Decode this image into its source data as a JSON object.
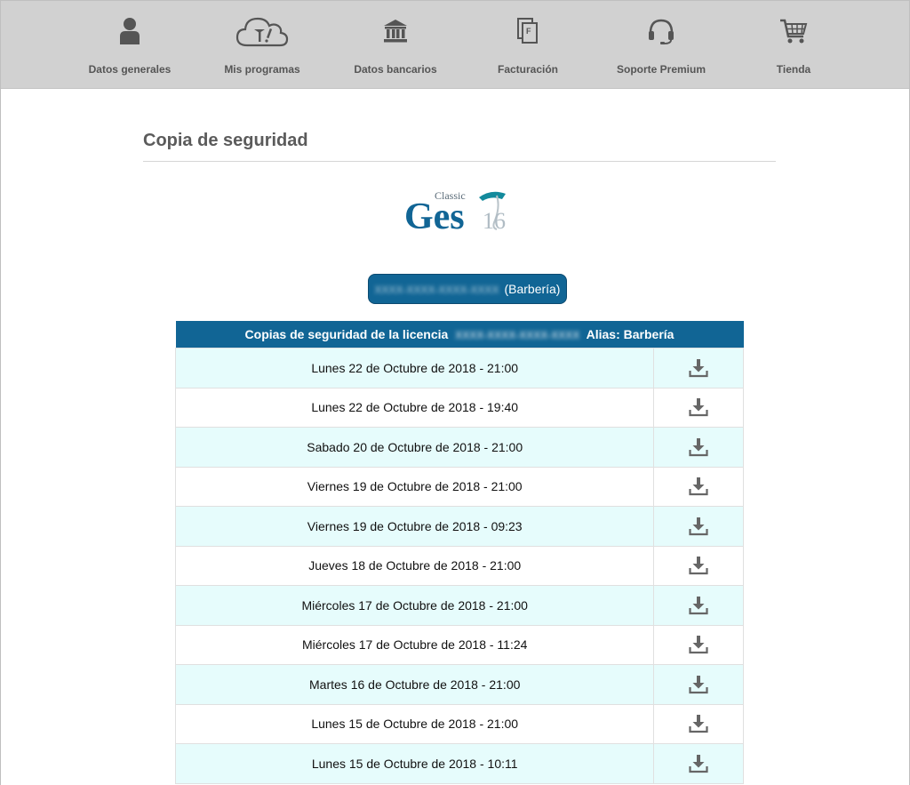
{
  "nav": {
    "items": [
      {
        "label": "Datos generales",
        "icon": "user-icon"
      },
      {
        "label": "Mis programas",
        "icon": "cloud-tools-icon"
      },
      {
        "label": "Datos bancarios",
        "icon": "bank-icon"
      },
      {
        "label": "Facturación",
        "icon": "invoice-icon"
      },
      {
        "label": "Soporte Premium",
        "icon": "headset-icon"
      },
      {
        "label": "Tienda",
        "icon": "cart-icon"
      }
    ]
  },
  "page": {
    "title": "Copia de seguridad"
  },
  "logo": {
    "classic": "Classic",
    "ges": "Ges",
    "version": "16",
    "brand_color": "#116595"
  },
  "license": {
    "alias_label": "(Barbería)"
  },
  "table": {
    "header_prefix": "Copias de seguridad de la licencia",
    "header_suffix": "Alias: Barbería",
    "rows": [
      {
        "date": "Lunes 22 de Octubre de 2018 - 21:00"
      },
      {
        "date": "Lunes 22 de Octubre de 2018 - 19:40"
      },
      {
        "date": "Sabado 20 de Octubre de 2018 - 21:00"
      },
      {
        "date": "Viernes 19 de Octubre de 2018 - 21:00"
      },
      {
        "date": "Viernes 19 de Octubre de 2018 - 09:23"
      },
      {
        "date": "Jueves 18 de Octubre de 2018 - 21:00"
      },
      {
        "date": "Miércoles 17 de Octubre de 2018 - 21:00"
      },
      {
        "date": "Miércoles 17 de Octubre de 2018 - 11:24"
      },
      {
        "date": "Martes 16 de Octubre de 2018 - 21:00"
      },
      {
        "date": "Lunes 15 de Octubre de 2018 - 21:00"
      },
      {
        "date": "Lunes 15 de Octubre de 2018 - 10:11"
      }
    ]
  },
  "colors": {
    "nav_bg": "#d1d1d1",
    "header_bg": "#116595",
    "row_alt": "#e6fcfc",
    "icon_gray": "#666666"
  }
}
